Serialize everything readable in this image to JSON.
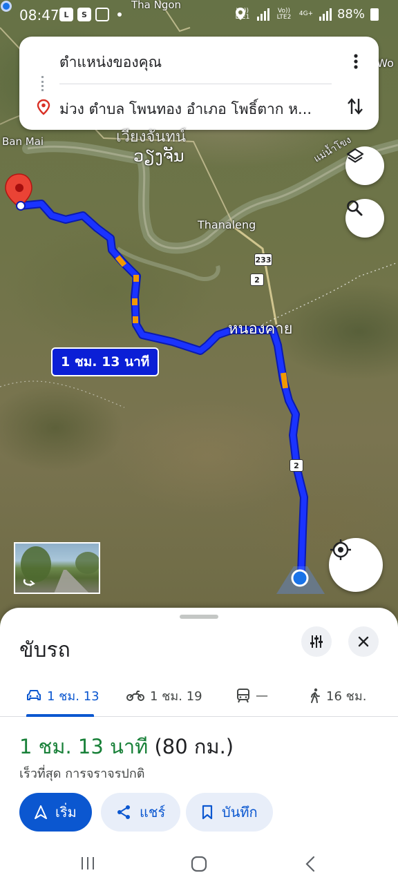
{
  "status_bar": {
    "time": "08:47",
    "app_icons": [
      "line-icon",
      "s-icon",
      "gallery-icon"
    ],
    "sim1": "Vo)) LTE1",
    "sim2": "Vo)) LTE2",
    "network": "4G+",
    "battery": "88%"
  },
  "map": {
    "top_label": "Tha Ngon",
    "right_edge_label": "n Wo",
    "left_label": "Ban Mai",
    "city_label_main": "เวียงจันทน์",
    "city_label_lao": "ວຽງຈັນ",
    "river_label": "แม่น้ำโขง",
    "place_thanaleng": "Thanaleng",
    "place_nongkhai": "หนองคาย",
    "route_shield_233": "233",
    "route_shield_2": "2",
    "route_time_chip": "1 ชม. 13 นาที"
  },
  "search": {
    "origin": "ตำแหน่งของคุณ",
    "destination": "ม่วง ตำบล โพนทอง อำเภอ โพธิ์ตาก ห..."
  },
  "sheet": {
    "title": "ขับรถ",
    "tabs": [
      {
        "mode": "car",
        "label": "1 ชม. 13"
      },
      {
        "mode": "motorcycle",
        "label": "1 ชม. 19"
      },
      {
        "mode": "transit",
        "label": "—"
      },
      {
        "mode": "walk",
        "label": "16 ชม."
      }
    ],
    "duration": "1 ชม. 13 นาที",
    "distance": "(80 กม.)",
    "subtitle": "เร็วที่สุด การจราจรปกติ",
    "start_label": "เริ่ม",
    "share_label": "แชร์",
    "save_label": "บันทึก"
  },
  "colors": {
    "route": "#1a33ff",
    "primary": "#0b57d0",
    "duration_green": "#188038",
    "pin_red": "#ea4335"
  }
}
